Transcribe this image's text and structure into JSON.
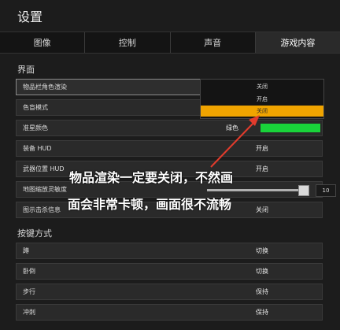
{
  "title": "设置",
  "tabs": [
    "图像",
    "控制",
    "声音",
    "游戏内容"
  ],
  "sections": {
    "interface": "界面",
    "keys": "按键方式"
  },
  "rows_interface": [
    {
      "label": "物品栏角色渲染",
      "value": "关闭"
    },
    {
      "label": "色盲模式",
      "value": ""
    },
    {
      "label": "准星颜色",
      "value": "绿色"
    },
    {
      "label": "装备 HUD",
      "value": "开启"
    },
    {
      "label": "武器位置 HUD",
      "value": "开启"
    },
    {
      "label": "地图缩放灵敏度",
      "value": "10"
    },
    {
      "label": "图示击杀信息",
      "value": "关闭"
    }
  ],
  "dropdown": {
    "options": [
      "开启",
      "关闭"
    ],
    "selected_index": 1
  },
  "slider": {
    "level": 0.95
  },
  "rows_keys": [
    {
      "label": "蹲",
      "value": "切换"
    },
    {
      "label": "卧倒",
      "value": "切换"
    },
    {
      "label": "步行",
      "value": "保持"
    },
    {
      "label": "冲刺",
      "value": "保持"
    }
  ],
  "annotation": {
    "line1": "物品渲染一定要关闭，不然画",
    "line2": "面会非常卡顿，画面很不流畅"
  },
  "colors": {
    "accent": "#f0a400",
    "crosshair": "#19d33a",
    "arrow": "#e23b2c"
  }
}
